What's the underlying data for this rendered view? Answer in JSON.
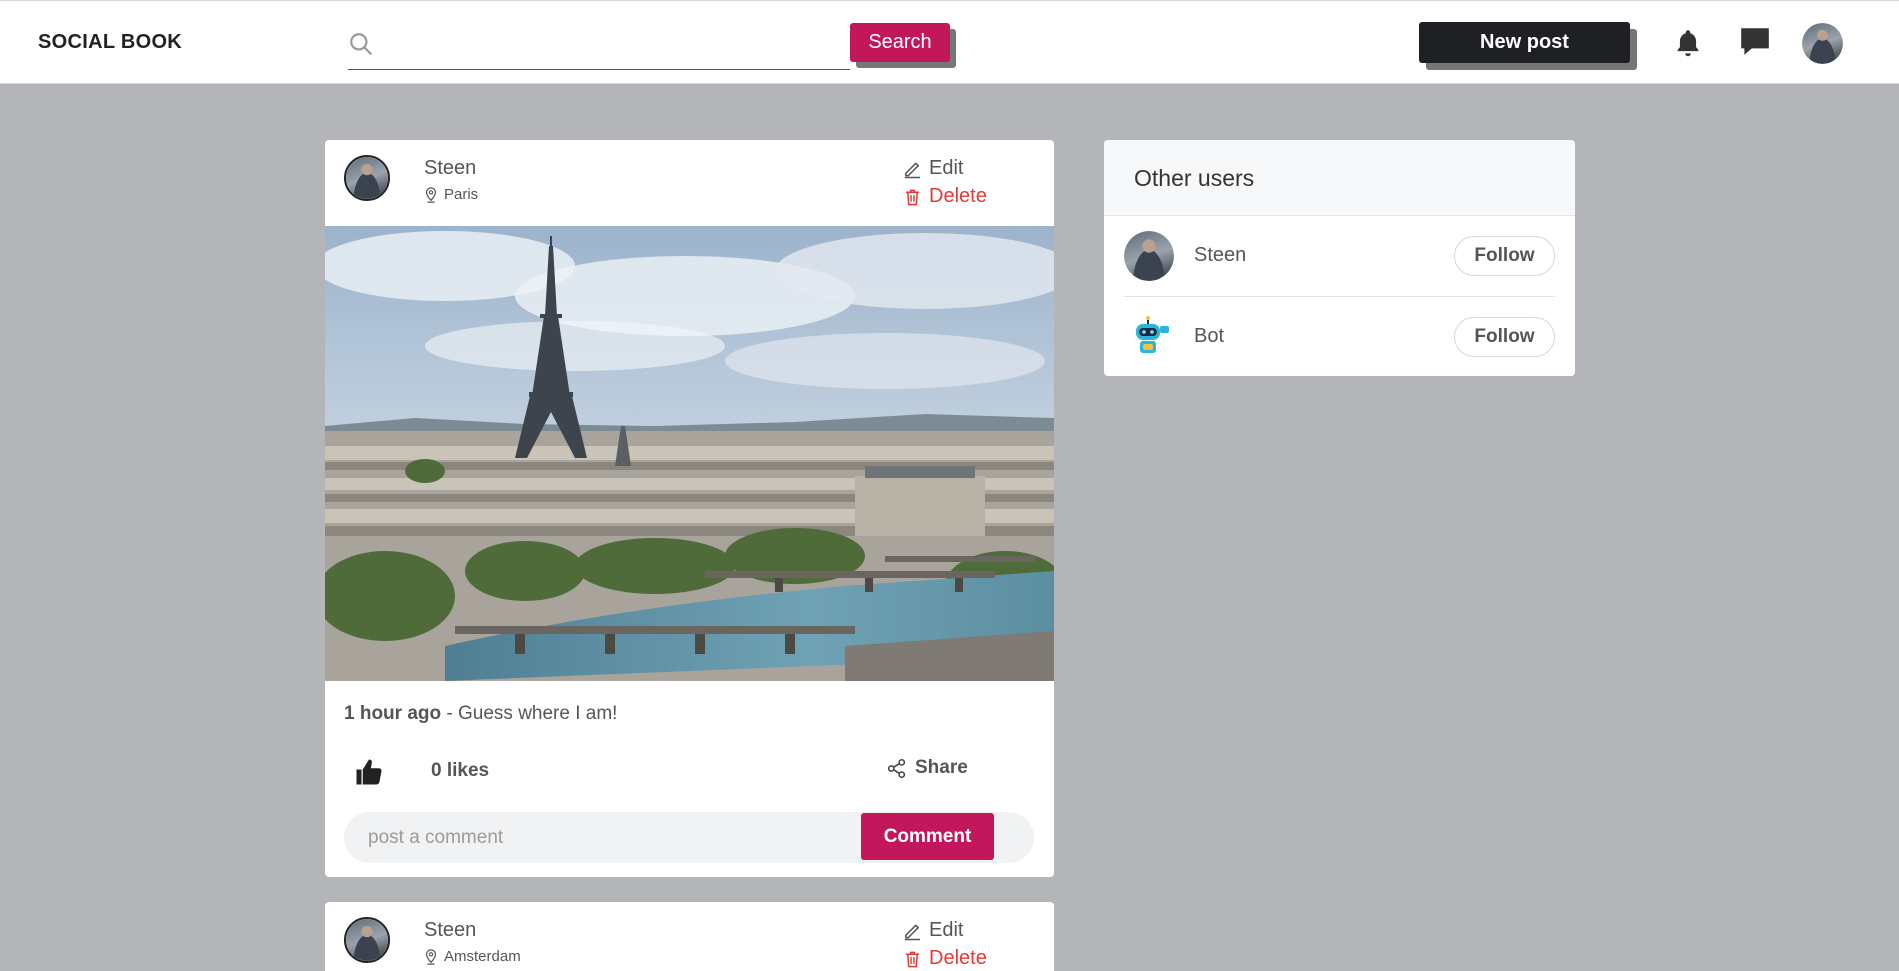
{
  "header": {
    "brand": "SOCIAL BOOK",
    "search_placeholder": "",
    "search_button": "Search",
    "new_post_button": "New post",
    "icons": [
      "search-icon",
      "bell-icon",
      "chat-icon",
      "avatar"
    ]
  },
  "posts": [
    {
      "author": "Steen",
      "location": "Paris",
      "edit_label": "Edit",
      "delete_label": "Delete",
      "time": "1 hour ago",
      "separator": " - ",
      "text": "Guess where I am!",
      "likes": "0 likes",
      "share_label": "Share",
      "comment_placeholder": "post a comment",
      "comment_button": "Comment"
    },
    {
      "author": "Steen",
      "location": "Amsterdam",
      "edit_label": "Edit",
      "delete_label": "Delete"
    }
  ],
  "other_users": {
    "title": "Other users",
    "users": [
      {
        "name": "Steen",
        "follow_label": "Follow"
      },
      {
        "name": "Bot",
        "follow_label": "Follow"
      }
    ]
  },
  "colors": {
    "accent": "#c2185b",
    "dark_button": "#1f2023",
    "delete": "#e53935",
    "page_background": "#b3b5b8"
  }
}
